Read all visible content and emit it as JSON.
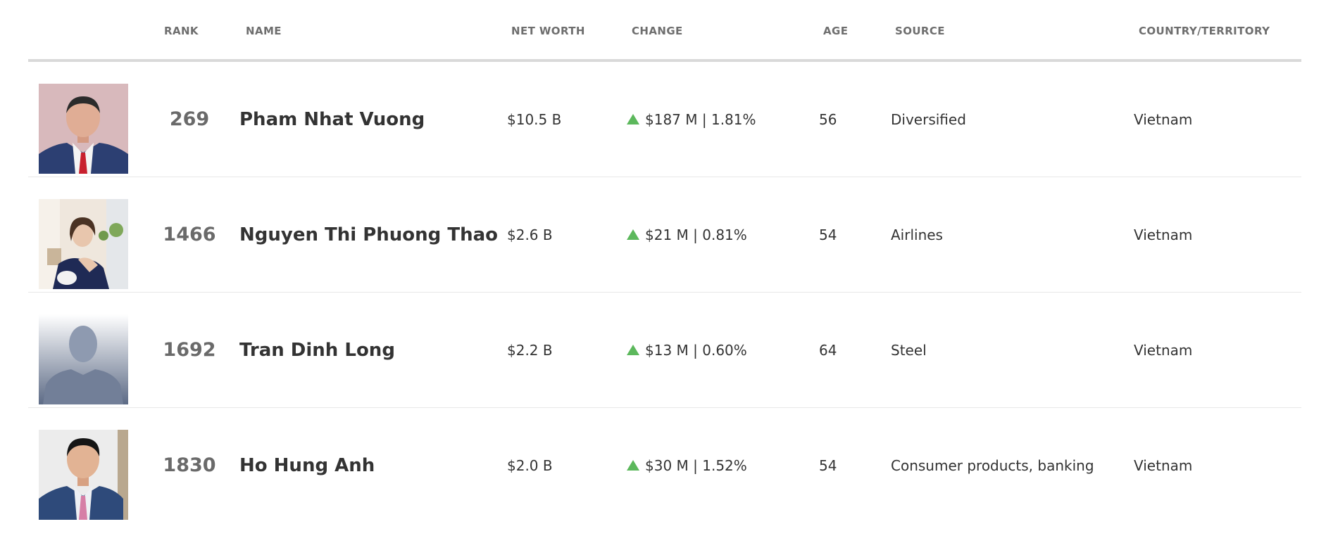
{
  "columns": {
    "rank": "RANK",
    "name": "NAME",
    "net_worth": "NET WORTH",
    "change": "CHANGE",
    "age": "AGE",
    "source": "SOURCE",
    "country": "COUNTRY/TERRITORY"
  },
  "change_color": "#5cb85c",
  "rows": [
    {
      "rank": "269",
      "name": "Pham Nhat Vuong",
      "net_worth": "$10.5 B",
      "change": "$187 M | 1.81%",
      "change_icon": "triangle-up-icon",
      "age": "56",
      "source": "Diversified",
      "country": "Vietnam",
      "photo": "man-in-suit-red-tie"
    },
    {
      "rank": "1466",
      "name": "Nguyen Thi Phuong Thao",
      "net_worth": "$2.6 B",
      "change": "$21 M | 0.81%",
      "change_icon": "triangle-up-icon",
      "age": "54",
      "source": "Airlines",
      "country": "Vietnam",
      "photo": "woman-seated-indoors"
    },
    {
      "rank": "1692",
      "name": "Tran Dinh Long",
      "net_worth": "$2.2 B",
      "change": "$13 M | 0.60%",
      "change_icon": "triangle-up-icon",
      "age": "64",
      "source": "Steel",
      "country": "Vietnam",
      "photo": "silhouette-placeholder"
    },
    {
      "rank": "1830",
      "name": "Ho Hung Anh",
      "net_worth": "$2.0 B",
      "change": "$30 M | 1.52%",
      "change_icon": "triangle-up-icon",
      "age": "54",
      "source": "Consumer products, banking",
      "country": "Vietnam",
      "photo": "man-in-suit-pink-tie"
    }
  ]
}
